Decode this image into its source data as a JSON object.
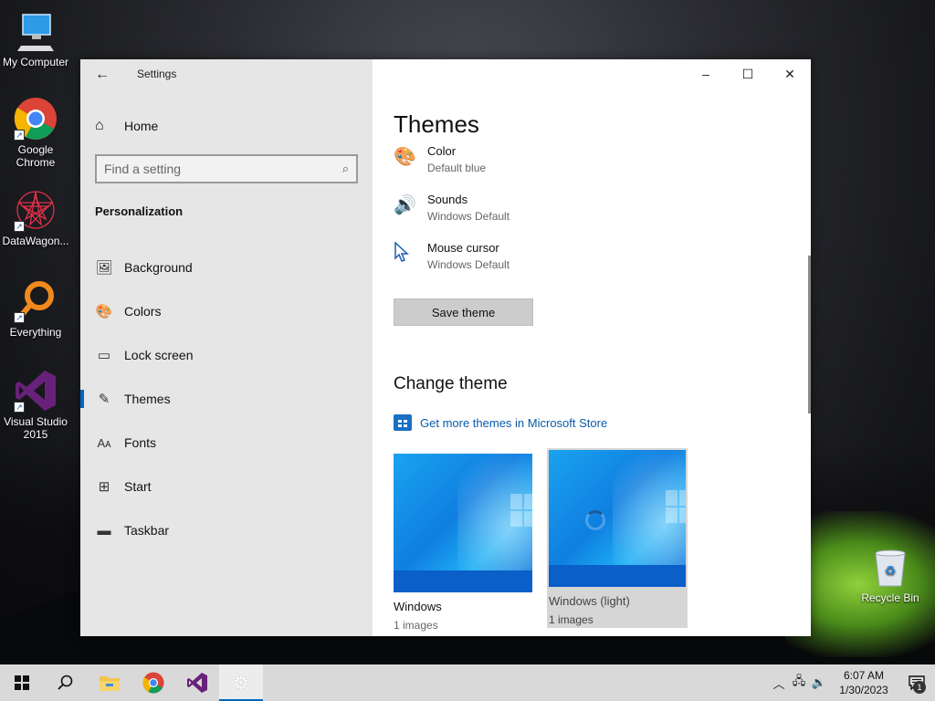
{
  "desktop": {
    "icons": [
      {
        "label": "My Computer"
      },
      {
        "label": "Google Chrome"
      },
      {
        "label": "DataWagon..."
      },
      {
        "label": "Everything"
      },
      {
        "label": "Visual Studio 2015"
      }
    ],
    "recycle_bin": "Recycle Bin"
  },
  "window": {
    "app_title": "Settings",
    "home_label": "Home",
    "search_placeholder": "Find a setting",
    "section_heading": "Personalization",
    "nav": [
      {
        "label": "Background",
        "icon": "image-icon"
      },
      {
        "label": "Colors",
        "icon": "palette-icon"
      },
      {
        "label": "Lock screen",
        "icon": "lock-screen-icon"
      },
      {
        "label": "Themes",
        "icon": "themes-icon",
        "active": true
      },
      {
        "label": "Fonts",
        "icon": "fonts-icon"
      },
      {
        "label": "Start",
        "icon": "start-icon"
      },
      {
        "label": "Taskbar",
        "icon": "taskbar-icon"
      }
    ],
    "controls": {
      "minimize": "–",
      "maximize": "☐",
      "close": "✕"
    }
  },
  "content": {
    "title": "Themes",
    "settings": [
      {
        "label": "Color",
        "value": "Default blue",
        "icon": "palette-icon"
      },
      {
        "label": "Sounds",
        "value": "Windows Default",
        "icon": "speaker-icon"
      },
      {
        "label": "Mouse cursor",
        "value": "Windows Default",
        "icon": "cursor-icon"
      }
    ],
    "save_theme": "Save theme",
    "change_theme_heading": "Change theme",
    "store_link": "Get more themes in Microsoft Store",
    "themes": [
      {
        "name": "Windows",
        "count": "1 images"
      },
      {
        "name": "Windows (light)",
        "count": "1 images",
        "selected": true
      }
    ]
  },
  "taskbar": {
    "time": "6:07 AM",
    "date": "1/30/2023",
    "notification_count": "1"
  },
  "colors": {
    "accent": "#0067c0",
    "link": "#0a5aa8",
    "sidebar_bg": "#e6e6e6",
    "taskbar_bg": "#d9d9d9"
  }
}
